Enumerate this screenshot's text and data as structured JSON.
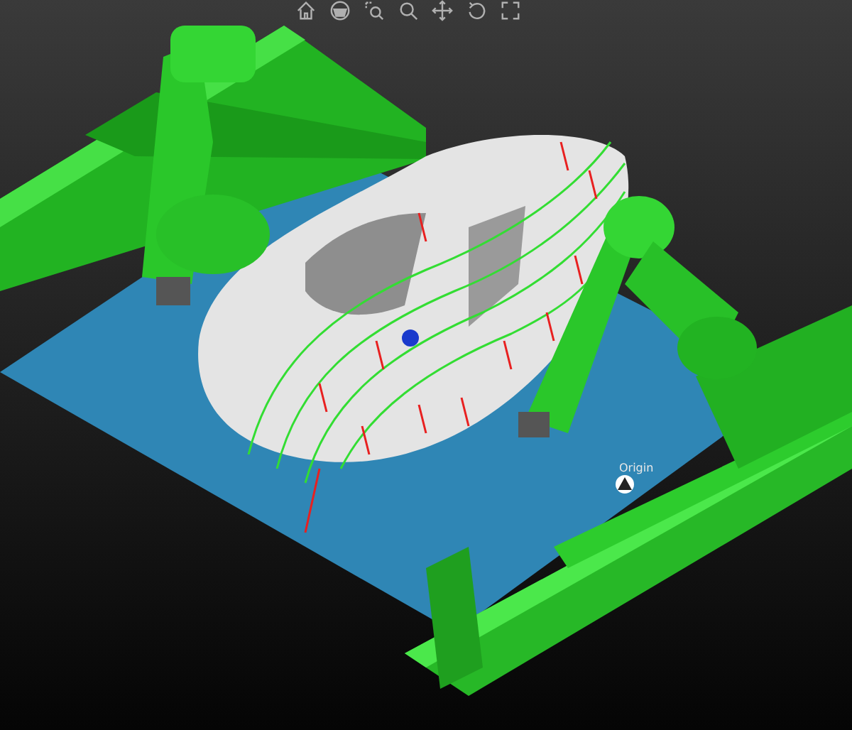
{
  "toolbar": {
    "buttons": [
      {
        "kind": "home"
      },
      {
        "kind": "orbit"
      },
      {
        "kind": "zoom-window"
      },
      {
        "kind": "zoom"
      },
      {
        "kind": "pan"
      },
      {
        "kind": "rotate"
      },
      {
        "kind": "fit"
      }
    ]
  },
  "viewport": {
    "origin_label": "Origin"
  }
}
